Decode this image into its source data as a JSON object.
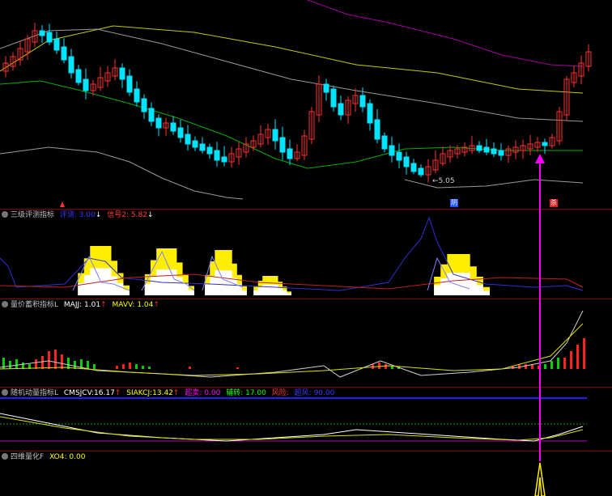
{
  "main_chart": {
    "low_label": "5.05",
    "tag_left": "阴",
    "tag_right": "杀"
  },
  "panels": [
    {
      "id": "p1",
      "name": "三级评测指标",
      "items": [
        {
          "label": "评测:",
          "value": "3.00",
          "arrow": "↓",
          "color": "#3a3aff"
        },
        {
          "label": "信号2:",
          "value": "5.82",
          "arrow": "↓",
          "color": "#ff3a3a"
        }
      ]
    },
    {
      "id": "p2",
      "name": "量价蓄积指标L",
      "items": [
        {
          "label": "MAJJ:",
          "value": "1.01",
          "arrow": "↑",
          "color": "#ffffff"
        },
        {
          "label": "MAVV:",
          "value": "1.04",
          "arrow": "↑",
          "color": "#ffff00"
        }
      ]
    },
    {
      "id": "p3",
      "name": "随机动量指标L",
      "items": [
        {
          "label": "CMSJCV:",
          "value": "16.17",
          "arrow": "↑",
          "color": "#ffffff"
        },
        {
          "label": "SIAKCJ:",
          "value": "13.42",
          "arrow": "↑",
          "color": "#ffff00"
        },
        {
          "label": "超卖:",
          "value": "0.00",
          "arrow": "",
          "color": "#ff00ff"
        },
        {
          "label": "辅转:",
          "value": "17.00",
          "arrow": "",
          "color": "#00ff00"
        },
        {
          "label": "风险:",
          "value": "",
          "arrow": "",
          "color": "#ff3a3a"
        },
        {
          "label": "超风:",
          "value": "90.00",
          "arrow": "",
          "color": "#3a3aff"
        }
      ]
    },
    {
      "id": "p4",
      "name": "四维量化F",
      "items": [
        {
          "label": "XO4:",
          "value": "0.00",
          "arrow": "",
          "color": "#ffff00"
        }
      ]
    }
  ],
  "colors": {
    "up": "#ff3030",
    "down": "#00e5ff",
    "signal": "#ff00ff",
    "ma_green": "#00b000",
    "ma_gray": "#9a9a9a",
    "ma_olive": "#c8c800",
    "ma_purple": "#a000a0"
  }
}
